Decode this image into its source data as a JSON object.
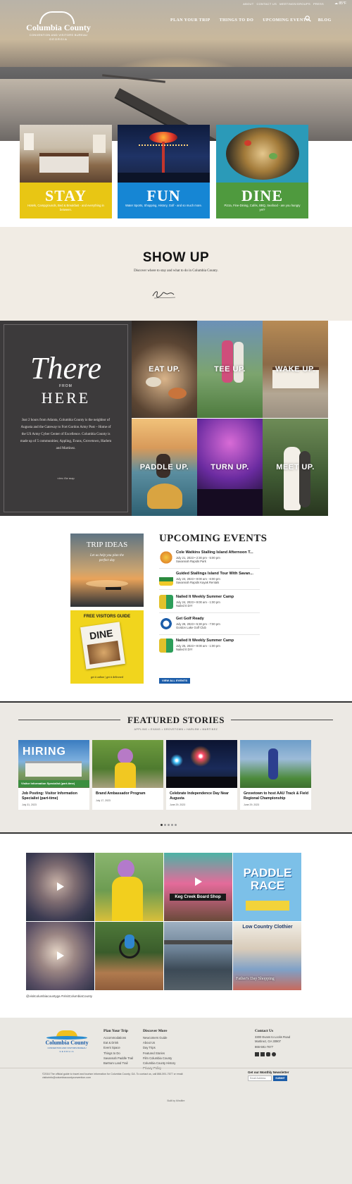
{
  "header": {
    "logo": {
      "line1": "Columbia County",
      "line2": "CONVENTION AND VISITORS BUREAU",
      "line3": "GEORGIA"
    },
    "top_links": [
      "ABOUT",
      "CONTACT US",
      "MEETINGS/GROUPS",
      "PRESS"
    ],
    "weather": "85°F",
    "nav": [
      "PLAN YOUR TRIP",
      "THINGS TO DO",
      "UPCOMING EVENTS",
      "BLOG"
    ]
  },
  "cards": [
    {
      "title": "STAY",
      "text": "Hotels, Campgrounds, Bed & Breakfast - and everything in between.",
      "color": "#e8c614"
    },
    {
      "title": "FUN",
      "text": "Water Sports, Shopping, History, Golf - and so much more.",
      "color": "#1686d4"
    },
    {
      "title": "DINE",
      "text": "Pizza, Fine-Dining, Cafés, BBQ, Seafood - are you hungry yet?",
      "color": "#4f9a3e"
    }
  ],
  "showup": {
    "heading": "SHOW UP",
    "text": "Discover where to stay and what to do in Columbia County.",
    "signature": "Stay Awhile"
  },
  "there": {
    "title": "There",
    "from": "FROM",
    "here": "HERE",
    "body": "Just 2 hours from Atlanta, Columbia County is the neighbor of Augusta and the Gateway to Fort Gordon Army Post – Home of the US Army Cyber Center of Excellence. Columbia County is made up of 5 communities; Appling, Evans, Grovetown, Harlem and Martinez.",
    "link": "view the map"
  },
  "tiles": [
    "EAT UP.",
    "TEE UP.",
    "WAKE UP.",
    "PADDLE UP.",
    "TURN UP.",
    "MEET UP."
  ],
  "promos": {
    "trip": {
      "title": "TRIP IDEAS",
      "sub": "Let us help you plan the perfect day"
    },
    "guide": {
      "title": "FREE VISITORS GUIDE",
      "cover": "DINE",
      "links": "get it online  |  get it delivered"
    }
  },
  "events": {
    "heading": "UPCOMING EVENTS",
    "items": [
      {
        "title": "Cole Watkins Stalling Island Afternoon T...",
        "date": "July 21, 2023  •  2:30 pm - 5:00 pm",
        "loc": "Savannah Rapids Park"
      },
      {
        "title": "Guided Stallings Island Tour With Savan...",
        "date": "July 23, 2023  •  9:00 am - 6:00 pm",
        "loc": "Savannah Rapids Kayak Rentals"
      },
      {
        "title": "Nailed It Weekly Summer Camp",
        "date": "July 24, 2023  •  9:00 am - 1:00 pm",
        "loc": "Nailed It DIY"
      },
      {
        "title": "Get Golf Ready",
        "date": "July 28, 2023  •  5:30 pm - 7:00 pm",
        "loc": "Gordon Lake Golf Club"
      },
      {
        "title": "Nailed It Weekly Summer Camp",
        "date": "July 25, 2023  •  9:00 am - 1:00 pm",
        "loc": "Nailed It DIY"
      }
    ],
    "view_all": "VIEW ALL EVENTS"
  },
  "featured": {
    "heading": "FEATURED STORIES",
    "tags": "APPLING  •  EVANS  •  GROVETOWN  •  HARLEM  •  MARTINEZ",
    "stories": [
      {
        "title": "Job Posting: Visitor Information Specialist (part-time)",
        "date": "July 31, 2023",
        "overlay": "HIRING",
        "banner": "Visitor Information Specialist (part-time)"
      },
      {
        "title": "Brand Ambassador Program",
        "date": "July 17, 2023"
      },
      {
        "title": "Celebrate Independence Day Near Augusta",
        "date": "June 29, 2023"
      },
      {
        "title": "Grovetown to host AAU Track & Field Regional Championship",
        "date": "June 29, 2023"
      }
    ]
  },
  "instagram": {
    "caption": "@visitcolumbiacountyga  #VisitColumbiaCounty",
    "labels": {
      "kegcreek": "Keg Creek Board Shop",
      "paddle": "PADDLE RACE",
      "fathers": "Father's Day Shopping",
      "lowcountry": "Low Country Clothier"
    }
  },
  "footer": {
    "plan": {
      "heading": "Plan Your Trip",
      "items": [
        "Accommodations",
        "Eat & Drink",
        "Event Space",
        "Things to Do",
        "Savannah Paddle Trail",
        "Bartram Land Trail"
      ]
    },
    "discover": {
      "heading": "Discover More",
      "items": [
        "Newcomers Guide",
        "About Us",
        "Day Trips",
        "Featured Stories",
        "Film Columbia County",
        "Columbia County History",
        "Privacy Policy"
      ]
    },
    "contact": {
      "heading": "Contact Us",
      "address": "3300 Evans to Locks Road",
      "city": "Martinez, GA 30907",
      "phone": "866-591-7677"
    },
    "copyright": "©2016 The official guide to travel and tourism information for Columbia County, GA. To contact us, call 866-591-7677 or email: visitorinfo@columbiacountyconvention.com",
    "newsletter": {
      "label": "Get our Monthly Newsletter",
      "placeholder": "Email Address",
      "button": "SUBMIT"
    },
    "built": "Built by Mindfire"
  }
}
